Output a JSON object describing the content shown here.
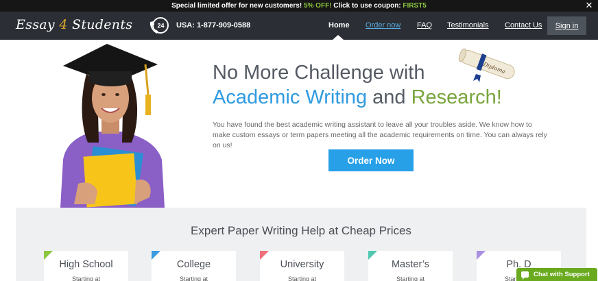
{
  "promo": {
    "prefix": "Special limited offer for new customers!",
    "discount": "5% OFF!",
    "middle": "Click to use coupon:",
    "coupon": "FIRST5",
    "close_glyph": "✕"
  },
  "header": {
    "logo_part1": "Essay",
    "logo_part2": "4",
    "logo_part3": "Students",
    "phone_badge": "24",
    "phone": "USA: 1-877-909-0588",
    "nav": [
      "Home",
      "Order now",
      "FAQ",
      "Testimonials",
      "Contact Us"
    ],
    "signin": "Sign in"
  },
  "hero": {
    "headline_line1": "No More Challenge with",
    "headline_blue": "Academic Writing",
    "headline_and": "and",
    "headline_green": "Research!",
    "description": "You have found the best academic writing assistant to leave all your troubles aside. We know how to make custom essays or term papers meeting all the academic requirements on time. You can always rely on us!",
    "order_button": "Order Now",
    "diploma_text": "Diploma"
  },
  "pricing": {
    "title": "Expert Paper Writing Help at Cheap Prices",
    "levels": [
      {
        "name": "High School",
        "starting": "Starting at",
        "color": "#8cc63f"
      },
      {
        "name": "College",
        "starting": "Starting at",
        "color": "#3d9be0"
      },
      {
        "name": "University",
        "starting": "Starting at",
        "color": "#ef6f7b"
      },
      {
        "name": "Master’s",
        "starting": "Starting at",
        "color": "#4fc8b0"
      },
      {
        "name": "Ph. D",
        "starting": "Starting at",
        "color": "#a98fe0"
      }
    ]
  },
  "chat": {
    "label": "Chat with Support"
  },
  "colors": {
    "accent_blue": "#27a0e8",
    "accent_green": "#8cc63f",
    "header_bg": "#2b2e34"
  }
}
